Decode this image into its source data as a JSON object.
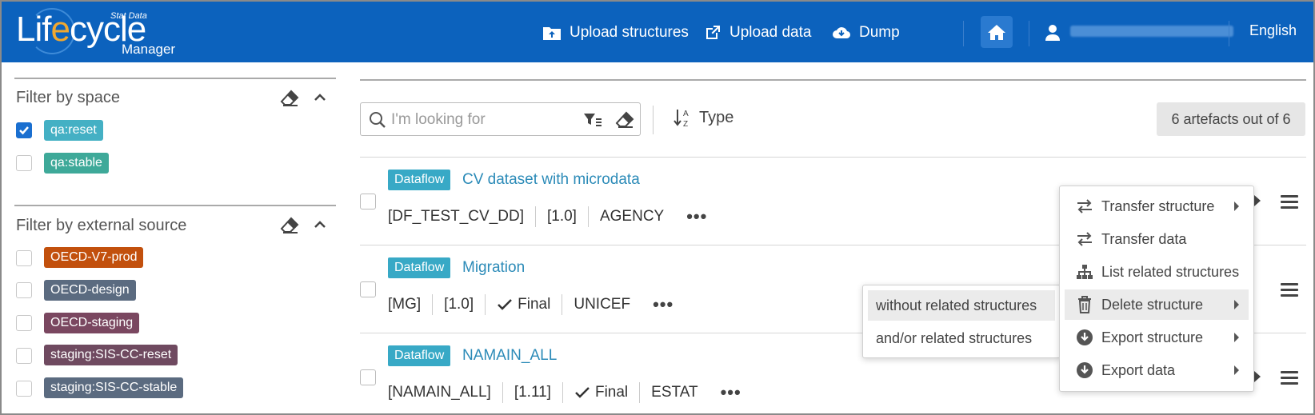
{
  "colors": {
    "header_bg": "#0c62bd",
    "link": "#2c8bb8",
    "dataflow_badge": "#38a9c6",
    "checkbox_checked": "#1a6fd0"
  },
  "header": {
    "logo": {
      "part1": "Lif",
      "e": "e",
      "part2": "cycle",
      "stat": "Stat Data",
      "manager": "Manager"
    },
    "nav": [
      {
        "label": "Upload structures",
        "icon": "upload-folder-icon"
      },
      {
        "label": "Upload data",
        "icon": "external-link-icon"
      },
      {
        "label": "Dump",
        "icon": "cloud-download-icon"
      }
    ],
    "home_icon": "home-icon",
    "user_icon": "user-icon",
    "language": "English"
  },
  "sidebar": {
    "space_filter": {
      "title": "Filter by space",
      "items": [
        {
          "label": "qa:reset",
          "checked": true,
          "color": "#44b0c4"
        },
        {
          "label": "qa:stable",
          "checked": false,
          "color": "#3ea999"
        }
      ]
    },
    "source_filter": {
      "title": "Filter by external source",
      "items": [
        {
          "label": "OECD-V7-prod",
          "checked": false,
          "color": "#c2500d"
        },
        {
          "label": "OECD-design",
          "checked": false,
          "color": "#5b6b80"
        },
        {
          "label": "OECD-staging",
          "checked": false,
          "color": "#7a4760"
        },
        {
          "label": "staging:SIS-CC-reset",
          "checked": false,
          "color": "#6f4a60"
        },
        {
          "label": "staging:SIS-CC-stable",
          "checked": false,
          "color": "#5b6b80"
        }
      ]
    }
  },
  "toolbar": {
    "search_placeholder": "I'm looking for",
    "sort_label": "Type",
    "count_label": "6 artefacts out of 6"
  },
  "artefacts": [
    {
      "type": "Dataflow",
      "title": "CV dataset with microdata",
      "id": "[DF_TEST_CV_DD]",
      "version": "[1.0]",
      "final": "",
      "agency": "AGENCY"
    },
    {
      "type": "Dataflow",
      "title": "Migration",
      "id": "[MG]",
      "version": "[1.0]",
      "final": "Final",
      "agency": "UNICEF"
    },
    {
      "type": "Dataflow",
      "title": "NAMAIN_ALL",
      "id": "[NAMAIN_ALL]",
      "version": "[1.11]",
      "final": "Final",
      "agency": "ESTAT"
    }
  ],
  "context_menu": {
    "items": [
      {
        "label": "Transfer structure",
        "icon": "transfer-icon",
        "submenu": true
      },
      {
        "label": "Transfer data",
        "icon": "transfer-icon",
        "submenu": false
      },
      {
        "label": "List related structures",
        "icon": "sitemap-icon",
        "submenu": false
      },
      {
        "label": "Delete structure",
        "icon": "trash-icon",
        "submenu": true
      },
      {
        "label": "Export structure",
        "icon": "download-circle-icon",
        "submenu": true
      },
      {
        "label": "Export data",
        "icon": "download-circle-icon",
        "submenu": true
      }
    ],
    "delete_submenu": [
      "without related structures",
      "and/or related structures"
    ]
  }
}
